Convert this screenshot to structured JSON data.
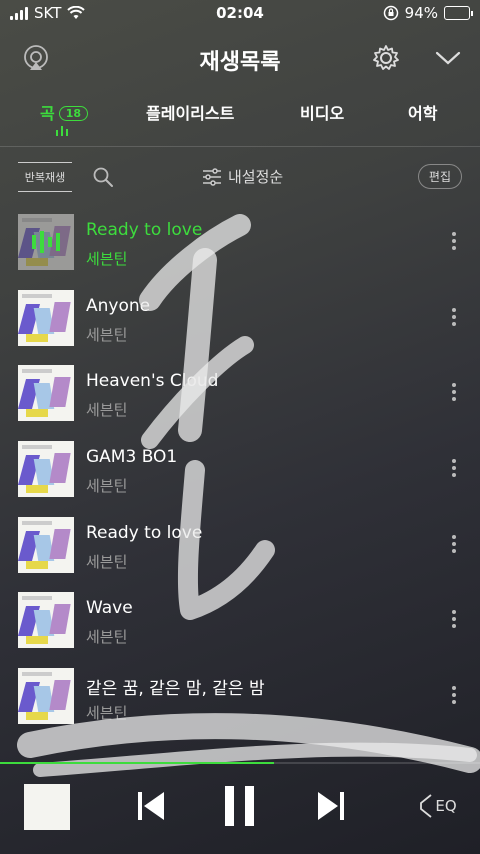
{
  "status": {
    "carrier": "SKT",
    "time": "02:04",
    "battery": "94%"
  },
  "header": {
    "title": "재생목록"
  },
  "tabs": [
    {
      "label": "곡",
      "count": "18"
    },
    {
      "label": "플레이리스트"
    },
    {
      "label": "비디오"
    },
    {
      "label": "어학"
    }
  ],
  "toolbar": {
    "repeat_label": "반복재생",
    "sort_label": "내설정순",
    "edit_label": "편집"
  },
  "songs": [
    {
      "title": "Ready to love",
      "artist": "세븐틴",
      "playing": true
    },
    {
      "title": "Anyone",
      "artist": "세븐틴"
    },
    {
      "title": "Heaven's Cloud",
      "artist": "세븐틴"
    },
    {
      "title": "GAM3 BO1",
      "artist": "세븐틴"
    },
    {
      "title": "Ready to love",
      "artist": "세븐틴"
    },
    {
      "title": "Wave",
      "artist": "세븐틴"
    },
    {
      "title": "같은 꿈, 같은 맘, 같은 밤",
      "artist": "세븐틴"
    }
  ],
  "player": {
    "eq_label": "EQ",
    "progress": 0.57
  },
  "colors": {
    "accent": "#3ddc3d",
    "battery": "#2ecc40"
  }
}
